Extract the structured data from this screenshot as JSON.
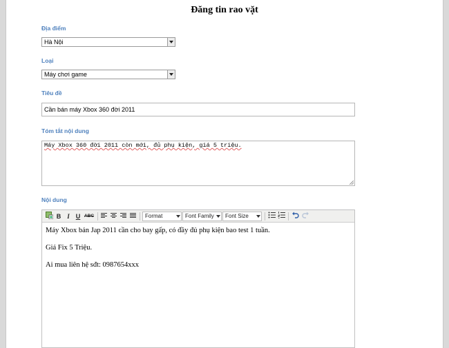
{
  "page": {
    "title": "Đăng tin rao vặt"
  },
  "fields": {
    "location": {
      "label": "Địa điểm",
      "value": "Hà Nội"
    },
    "category": {
      "label": "Loại",
      "value": "Máy chơi game"
    },
    "title": {
      "label": "Tiêu đề",
      "value": "Cần bán máy Xbox 360 đời 2011"
    },
    "summary": {
      "label": "Tóm tắt nội dung",
      "value": "Máy Xbox 360 đời 2011 còn mới, đủ phụ kiện, giá 5 triệu."
    },
    "content": {
      "label": "Nội dung"
    }
  },
  "editor": {
    "toolbar": {
      "bold": "B",
      "italic": "I",
      "underline": "U",
      "strike": "ABC",
      "format": "Format",
      "font_family": "Font Family",
      "font_size": "Font Size"
    },
    "paragraphs": [
      "Máy Xbox bản Jap 2011 cần cho bay gấp, có đầy đủ phụ kiện bao test 1 tuần.",
      "Giá Fix 5 Triệu.",
      "Ai mua liên hệ sđt: 0987654xxx"
    ]
  }
}
